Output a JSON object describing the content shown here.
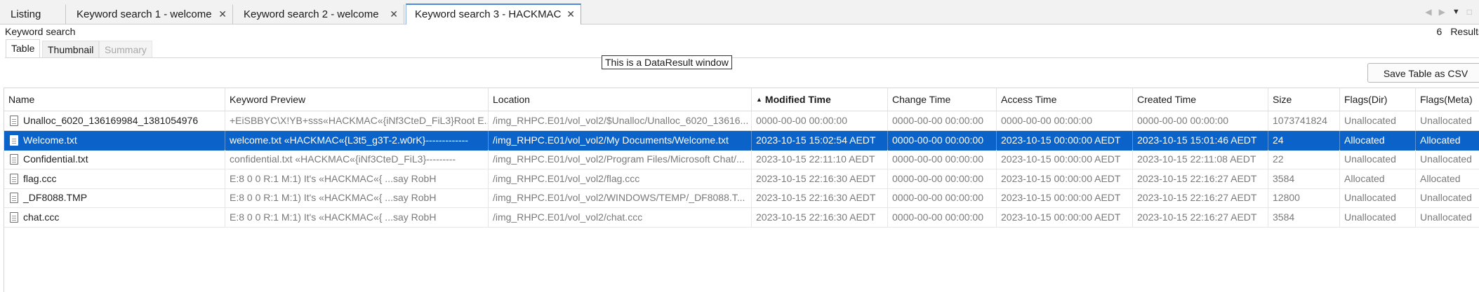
{
  "tabs": [
    {
      "label": "Listing",
      "closable": false,
      "active": false
    },
    {
      "label": "Keyword search 1 - welcome",
      "closable": true,
      "active": false
    },
    {
      "label": "Keyword search 2 - welcome",
      "closable": true,
      "active": false
    },
    {
      "label": "Keyword search 3 - HACKMAC",
      "closable": true,
      "active": true
    }
  ],
  "tab_close_glyph": "✕",
  "header": {
    "title": "Keyword search",
    "results_count": "6",
    "results_label": "Results"
  },
  "subtabs": [
    {
      "label": "Table",
      "state": "active"
    },
    {
      "label": "Thumbnail",
      "state": "inactive"
    },
    {
      "label": "Summary",
      "state": "disabled"
    }
  ],
  "window_label": "This is a DataResult window",
  "toolbar": {
    "save_csv_label": "Save Table as CSV"
  },
  "table": {
    "columns": [
      "Name",
      "Keyword Preview",
      "Location",
      "Modified Time",
      "Change Time",
      "Access Time",
      "Created Time",
      "Size",
      "Flags(Dir)",
      "Flags(Meta)"
    ],
    "sorted_column": "Modified Time",
    "sort_direction": "ascending",
    "rows": [
      {
        "selected": false,
        "cells": [
          "Unalloc_6020_136169984_1381054976",
          "+EiSBBYC\\X!YB+sss«HACKMAC«{iNf3CteD_FiL3}Root E...",
          "/img_RHPC.E01/vol_vol2/$Unalloc/Unalloc_6020_13616...",
          "0000-00-00 00:00:00",
          "0000-00-00 00:00:00",
          "0000-00-00 00:00:00",
          "0000-00-00 00:00:00",
          "1073741824",
          "Unallocated",
          "Unallocated"
        ]
      },
      {
        "selected": true,
        "cells": [
          "Welcome.txt",
          "welcome.txt «HACKMAC«{L3t5_g3T-2.w0rK}-------------",
          "/img_RHPC.E01/vol_vol2/My Documents/Welcome.txt",
          "2023-10-15 15:02:54 AEDT",
          "0000-00-00 00:00:00",
          "2023-10-15 00:00:00 AEDT",
          "2023-10-15 15:01:46 AEDT",
          "24",
          "Allocated",
          "Allocated"
        ]
      },
      {
        "selected": false,
        "cells": [
          "Confidential.txt",
          "confidential.txt «HACKMAC«{iNf3CteD_FiL3}---------",
          "/img_RHPC.E01/vol_vol2/Program Files/Microsoft Chat/...",
          "2023-10-15 22:11:10 AEDT",
          "0000-00-00 00:00:00",
          "2023-10-15 00:00:00 AEDT",
          "2023-10-15 22:11:08 AEDT",
          "22",
          "Unallocated",
          "Unallocated"
        ]
      },
      {
        "selected": false,
        "cells": [
          "flag.ccc",
          "E:8 0 0 R:1 M:1)       It's «HACKMAC«{ ...say       RobH",
          "/img_RHPC.E01/vol_vol2/flag.ccc",
          "2023-10-15 22:16:30 AEDT",
          "0000-00-00 00:00:00",
          "2023-10-15 00:00:00 AEDT",
          "2023-10-15 22:16:27 AEDT",
          "3584",
          "Allocated",
          "Allocated"
        ]
      },
      {
        "selected": false,
        "cells": [
          "_DF8088.TMP",
          "E:8 0 0 R:1 M:1)       It's «HACKMAC«{ ...say       RobH",
          "/img_RHPC.E01/vol_vol2/WINDOWS/TEMP/_DF8088.T...",
          "2023-10-15 22:16:30 AEDT",
          "0000-00-00 00:00:00",
          "2023-10-15 00:00:00 AEDT",
          "2023-10-15 22:16:27 AEDT",
          "12800",
          "Unallocated",
          "Unallocated"
        ]
      },
      {
        "selected": false,
        "cells": [
          "chat.ccc",
          "E:8 0 0 R:1 M:1)       It's «HACKMAC«{ ...say       RobH",
          "/img_RHPC.E01/vol_vol2/chat.ccc",
          "2023-10-15 22:16:30 AEDT",
          "0000-00-00 00:00:00",
          "2023-10-15 00:00:00 AEDT",
          "2023-10-15 22:16:27 AEDT",
          "3584",
          "Unallocated",
          "Unallocated"
        ]
      }
    ]
  },
  "colors": {
    "selection": "#0b63c9",
    "active_tab_border": "#4a8ad8"
  },
  "icons": {
    "row_icon": "file-icon",
    "sort_icon": "sort-ascending-icon"
  }
}
